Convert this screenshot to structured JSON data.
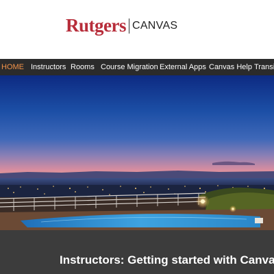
{
  "header": {
    "logo_word": "Rutgers",
    "logo_sub": "CANVAS"
  },
  "nav": {
    "items": [
      {
        "label": "HOME",
        "active": true
      },
      {
        "label": "Instructors",
        "active": false
      },
      {
        "label": "Rooms",
        "active": false
      },
      {
        "label": "Course Migration",
        "active": false
      },
      {
        "label": "External Apps",
        "active": false
      },
      {
        "label": "Canvas Help",
        "active": false
      },
      {
        "label": "Transiti",
        "active": false
      }
    ]
  },
  "banner": {
    "title": "Instructors: Getting started with Canva"
  },
  "colors": {
    "brand": "#b72d3a",
    "nav_bg": "#2b2b2b",
    "nav_active": "#f1934a",
    "banner_bg": "#3c3c3c"
  }
}
